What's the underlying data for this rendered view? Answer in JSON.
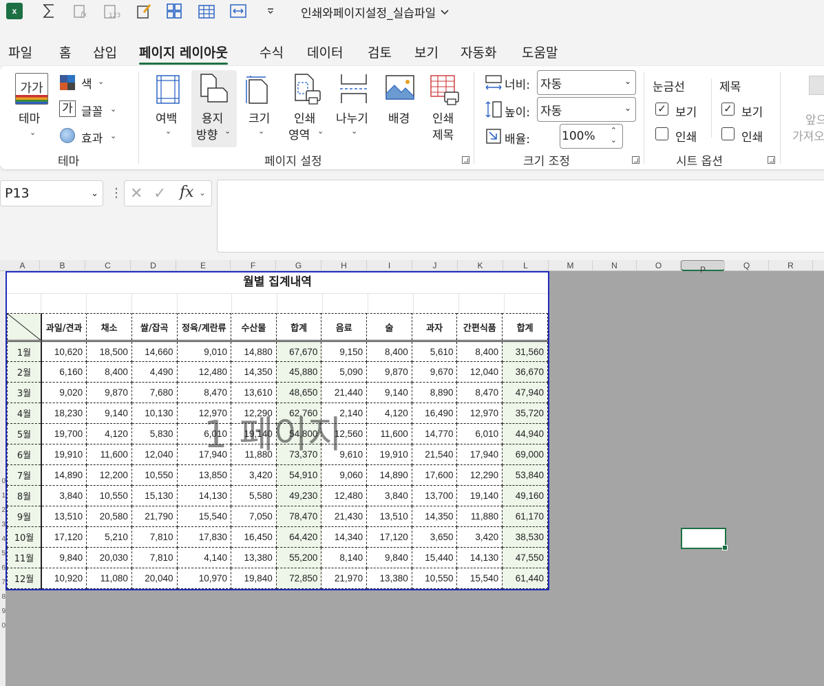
{
  "titlebar": {
    "app_logo_text": "x",
    "doc_title": "인쇄와페이지설정_실습파일"
  },
  "tabs": [
    "파일",
    "홈",
    "삽입",
    "페이지 레이아웃",
    "수식",
    "데이터",
    "검토",
    "보기",
    "자동화",
    "도움말"
  ],
  "active_tab": "페이지 레이아웃",
  "ribbon": {
    "theme_group": {
      "label": "테마",
      "theme_button": "테마",
      "theme_icon_text": "가가",
      "colors": "색",
      "fonts": "글꼴",
      "fonts_icon_text": "가",
      "effects": "효과"
    },
    "page_setup_group": {
      "label": "페이지 설정",
      "margins": "여백",
      "orientation_1": "용지",
      "orientation_2": "방향",
      "size": "크기",
      "print_area_1": "인쇄",
      "print_area_2": "영역",
      "breaks": "나누기",
      "background": "배경",
      "print_titles_1": "인쇄",
      "print_titles_2": "제목"
    },
    "scale_group": {
      "label": "크기 조정",
      "width_label": "너비:",
      "width_value": "자동",
      "height_label": "높이:",
      "height_value": "자동",
      "scale_label": "배율:",
      "scale_value": "100%"
    },
    "sheet_options_group": {
      "label": "시트 옵션",
      "gridlines": "눈금선",
      "headings": "제목",
      "view": "보기",
      "print": "인쇄",
      "gridlines_view_checked": true,
      "gridlines_print_checked": false,
      "headings_view_checked": true,
      "headings_print_checked": false
    },
    "arrange_group": {
      "bring_forward_1": "앞으",
      "bring_forward_2": "가져오"
    }
  },
  "formula_bar": {
    "name_box": "P13",
    "fx": "fx",
    "formula": ""
  },
  "sheet": {
    "columns": [
      "A",
      "B",
      "C",
      "D",
      "E",
      "F",
      "G",
      "H",
      "I",
      "J",
      "K",
      "L",
      "M",
      "N",
      "O",
      "P",
      "Q",
      "R"
    ],
    "selected_column": "P",
    "row_numbers": [
      "0",
      "1",
      "2",
      "3",
      "4",
      "5",
      "6",
      "7",
      "8",
      "9",
      "0"
    ],
    "page_watermark": "1 페이지",
    "colors": {
      "page_border": "#1f2bbf",
      "out_of_page": "#a5a5a5",
      "header_green": "#eef5e9",
      "accent": "#1d7044"
    }
  },
  "table": {
    "title": "월별 집계내역",
    "headers": [
      "과일/견과",
      "채소",
      "쌀/잡곡",
      "정육/계란류",
      "수산물",
      "합계",
      "음료",
      "술",
      "과자",
      "간편식품",
      "합계"
    ],
    "rows": [
      {
        "month": "1월",
        "values": [
          "10,620",
          "18,500",
          "14,660",
          "9,010",
          "14,880",
          "67,670",
          "9,150",
          "8,400",
          "5,610",
          "8,400",
          "31,560"
        ]
      },
      {
        "month": "2월",
        "values": [
          "6,160",
          "8,400",
          "4,490",
          "12,480",
          "14,350",
          "45,880",
          "5,090",
          "9,870",
          "9,670",
          "12,040",
          "36,670"
        ]
      },
      {
        "month": "3월",
        "values": [
          "9,020",
          "9,870",
          "7,680",
          "8,470",
          "13,610",
          "48,650",
          "21,440",
          "9,140",
          "8,890",
          "8,470",
          "47,940"
        ]
      },
      {
        "month": "4월",
        "values": [
          "18,230",
          "9,140",
          "10,130",
          "12,970",
          "12,290",
          "62,760",
          "2,140",
          "4,120",
          "16,490",
          "12,970",
          "35,720"
        ]
      },
      {
        "month": "5월",
        "values": [
          "19,700",
          "4,120",
          "5,830",
          "6,010",
          "19,140",
          "54,800",
          "12,560",
          "11,600",
          "14,770",
          "6,010",
          "44,940"
        ]
      },
      {
        "month": "6월",
        "values": [
          "19,910",
          "11,600",
          "12,040",
          "17,940",
          "11,880",
          "73,370",
          "9,610",
          "19,910",
          "21,540",
          "17,940",
          "69,000"
        ]
      },
      {
        "month": "7월",
        "values": [
          "14,890",
          "12,200",
          "10,550",
          "13,850",
          "3,420",
          "54,910",
          "9,060",
          "14,890",
          "17,600",
          "12,290",
          "53,840"
        ]
      },
      {
        "month": "8월",
        "values": [
          "3,840",
          "10,550",
          "15,130",
          "14,130",
          "5,580",
          "49,230",
          "12,480",
          "3,840",
          "13,700",
          "19,140",
          "49,160"
        ]
      },
      {
        "month": "9월",
        "values": [
          "13,510",
          "20,580",
          "21,790",
          "15,540",
          "7,050",
          "78,470",
          "21,430",
          "13,510",
          "14,350",
          "11,880",
          "61,170"
        ]
      },
      {
        "month": "10월",
        "values": [
          "17,120",
          "5,210",
          "7,810",
          "17,830",
          "16,450",
          "64,420",
          "14,340",
          "17,120",
          "3,650",
          "3,420",
          "38,530"
        ]
      },
      {
        "month": "11월",
        "values": [
          "9,840",
          "20,030",
          "7,810",
          "4,140",
          "13,380",
          "55,200",
          "8,140",
          "9,840",
          "15,440",
          "14,130",
          "47,550"
        ]
      },
      {
        "month": "12월",
        "values": [
          "10,920",
          "11,080",
          "20,040",
          "10,970",
          "19,840",
          "72,850",
          "21,970",
          "13,380",
          "10,550",
          "15,540",
          "61,440"
        ]
      }
    ]
  }
}
